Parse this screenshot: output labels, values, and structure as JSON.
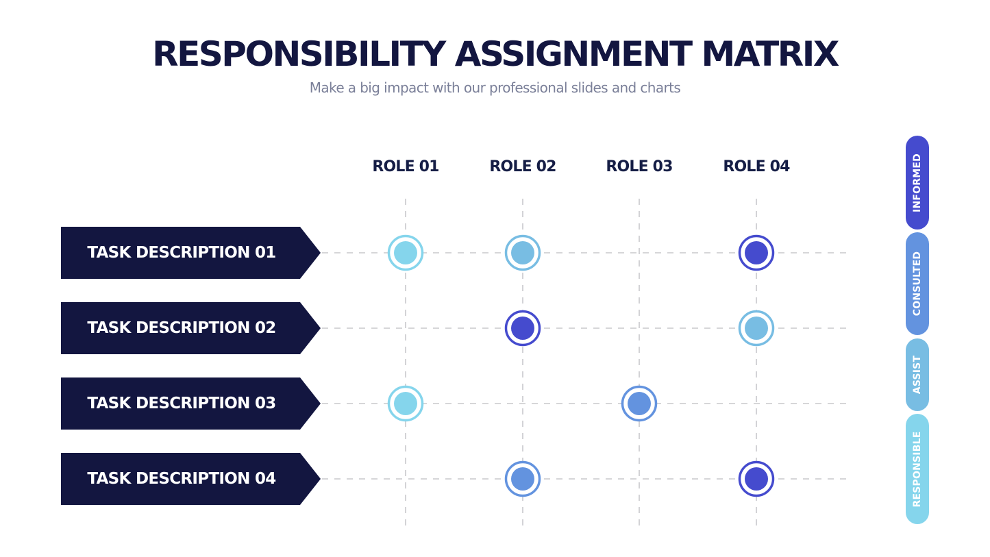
{
  "header": {
    "title": "RESPONSIBILITY ASSIGNMENT MATRIX",
    "subtitle": "Make a big impact with our professional slides and charts"
  },
  "legend": [
    {
      "key": "informed",
      "label": "INFORMED",
      "color": "#454BCE"
    },
    {
      "key": "consulted",
      "label": "CONSULTED",
      "color": "#6393DF"
    },
    {
      "key": "assist",
      "label": "ASSIST",
      "color": "#78BDE3"
    },
    {
      "key": "responsible",
      "label": "RESPONSIBLE",
      "color": "#85D5EC"
    }
  ],
  "chart_data": {
    "type": "table",
    "title": "RESPONSIBILITY ASSIGNMENT MATRIX",
    "subtitle": "Make a big impact with our professional slides and charts",
    "columns": [
      "ROLE 01",
      "ROLE 02",
      "ROLE 03",
      "ROLE 04"
    ],
    "rows": [
      "TASK DESCRIPTION 01",
      "TASK DESCRIPTION 02",
      "TASK DESCRIPTION 03",
      "TASK DESCRIPTION 04"
    ],
    "cells": [
      [
        "responsible",
        "assist",
        null,
        "informed"
      ],
      [
        null,
        "informed",
        null,
        "assist"
      ],
      [
        "responsible",
        null,
        "consulted",
        null
      ],
      [
        null,
        "consulted",
        null,
        "informed"
      ]
    ],
    "legend_position": "right",
    "grid": true
  },
  "colors": {
    "navy": "#131640",
    "grid_line": "#C8C8CC"
  }
}
